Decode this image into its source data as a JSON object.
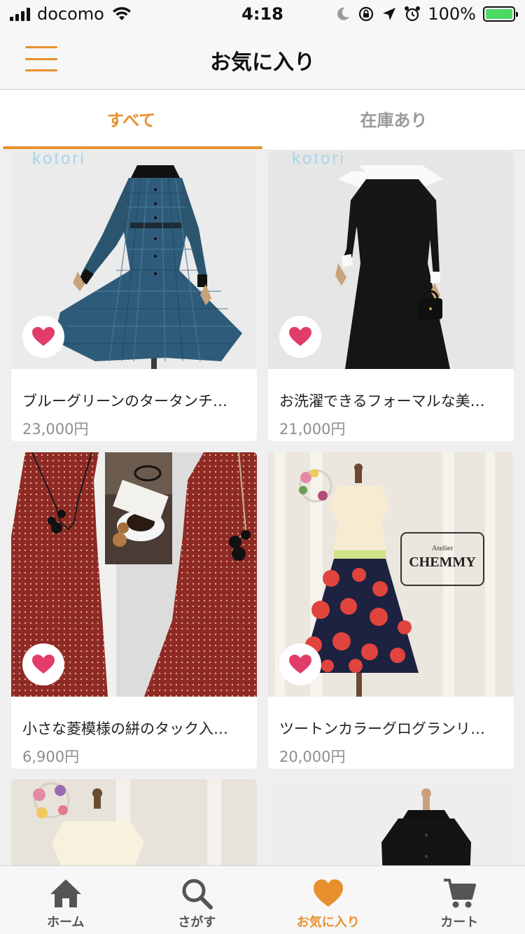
{
  "status_bar": {
    "carrier": "docomo",
    "time": "4:18",
    "battery": "100%"
  },
  "header": {
    "title": "お気に入り"
  },
  "tabs": [
    {
      "label": "すべて",
      "active": true
    },
    {
      "label": "在庫あり",
      "active": false
    }
  ],
  "products": [
    {
      "title": "ブルーグリーンのタータンチ…",
      "price": "23,000円",
      "favorited": true,
      "image_watermark": "kotori"
    },
    {
      "title": "お洗濯できるフォーマルな美…",
      "price": "21,000円",
      "favorited": true,
      "image_watermark": "kotori"
    },
    {
      "title": "小さな菱模様の絣のタック入…",
      "price": "6,900円",
      "favorited": true
    },
    {
      "title": "ツートンカラーグログランリ…",
      "price": "20,000円",
      "favorited": true,
      "image_logo": "CHEMMY"
    },
    {
      "title": "",
      "price": "",
      "favorited": false
    },
    {
      "title": "",
      "price": "",
      "favorited": false
    }
  ],
  "bottom_nav": [
    {
      "label": "ホーム",
      "icon": "home-icon",
      "active": false
    },
    {
      "label": "さがす",
      "icon": "search-icon",
      "active": false
    },
    {
      "label": "お気に入り",
      "icon": "heart-icon",
      "active": true
    },
    {
      "label": "カート",
      "icon": "cart-icon",
      "active": false
    }
  ],
  "colors": {
    "accent": "#e8902e",
    "heart": "#e23d6a",
    "price": "#8e8e8e"
  }
}
